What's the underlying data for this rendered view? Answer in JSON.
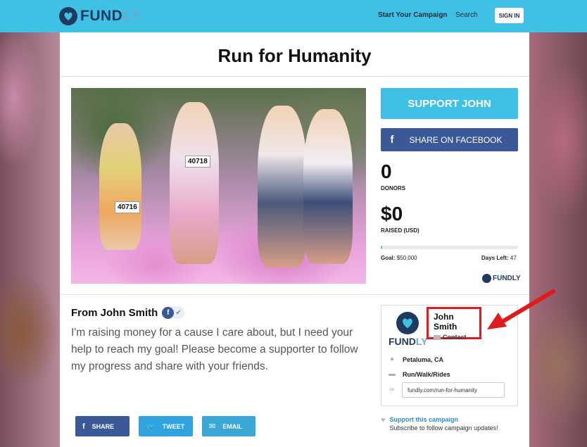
{
  "header": {
    "logo_main": "FUND",
    "logo_accent": "LY",
    "nav_start": "Start Your Campaign",
    "nav_search": "Search",
    "signin": "SIGN IN"
  },
  "campaign": {
    "title": "Run for Humanity",
    "photo_bibs": [
      "40718",
      "40716"
    ],
    "support_button": "SUPPORT JOHN",
    "facebook_share": "SHARE ON FACEBOOK",
    "donors_count": "0",
    "donors_label": "DONORS",
    "raised_amount": "$0",
    "raised_label": "RAISED (USD)",
    "progress_fraction": 0,
    "goal_label": "Goal:",
    "goal_value": "$50,000",
    "days_label": "Days Left:",
    "days_value": "47",
    "powered_logo": "FUNDLY"
  },
  "story": {
    "from_heading": "From John Smith",
    "description": "I'm raising money for a cause I care about, but I need your help to reach my goal! Please become a supporter to follow my progress and share with your friends."
  },
  "share": {
    "share_label": "SHARE",
    "tweet_label": "TWEET",
    "email_label": "EMAIL"
  },
  "owner": {
    "logo_main": "FUND",
    "logo_accent": "LY",
    "name": "John Smith",
    "contact": "Contact",
    "location": "Petaluma, CA",
    "category": "Run/Walk/Rides",
    "url": "fundly.com/run-for-humanity"
  },
  "subscribe": {
    "link": "Support this campaign",
    "text": "Subscribe to follow campaign updates!"
  },
  "colors": {
    "brand_blue": "#3fc1e6",
    "facebook": "#3b5998",
    "twitter": "#2fa3e0",
    "highlight_red": "#e01b1b"
  }
}
